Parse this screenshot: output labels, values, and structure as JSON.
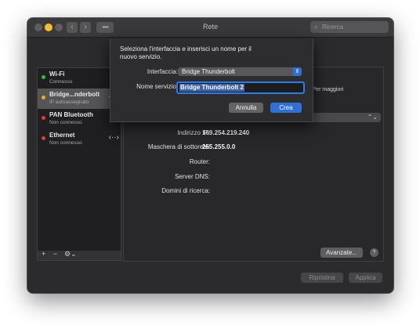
{
  "window": {
    "title": "Rete"
  },
  "search": {
    "placeholder": "Ricerca"
  },
  "services": [
    {
      "name": "Wi-Fi",
      "status": "Connesso",
      "dot_color": "#2fc02f",
      "icon": "wifi-icon"
    },
    {
      "name": "Bridge...nderbolt",
      "status": "IP autoassegnato",
      "dot_color": "#f5a623",
      "icon": "arrows-icon"
    },
    {
      "name": "PAN Bluetooth",
      "status": "Non connesso",
      "dot_color": "#e23a3a",
      "icon": "bluetooth-icon"
    },
    {
      "name": "Ethernet",
      "status": "Non connesso",
      "dot_color": "#e23a3a",
      "icon": "arrows-icon"
    }
  ],
  "main": {
    "truncated_text": "nesse. Per maggiori",
    "rows": [
      {
        "label": "Indirizzo IP:",
        "value": "169.254.219.240"
      },
      {
        "label": "Maschera di sottorete:",
        "value": "255.255.0.0"
      },
      {
        "label": "Router:",
        "value": ""
      },
      {
        "label": "Server DNS:",
        "value": ""
      },
      {
        "label": "Domini di ricerca:",
        "value": ""
      }
    ],
    "advanced_label": "Avanzate...",
    "help_label": "?",
    "revert_label": "Ripristina",
    "apply_label": "Applica"
  },
  "sheet": {
    "message": "Seleziona l'interfaccia e inserisci un nome per il nuovo servizio.",
    "interface_label": "Interfaccia:",
    "interface_value": "Bridge Thunderbolt",
    "service_label": "Nome servizio:",
    "service_value": "Bridge Thunderbolt 2",
    "cancel_label": "Annulla",
    "create_label": "Crea"
  },
  "sidebar_tools": {
    "add": "+",
    "remove": "−",
    "action": "⚙︎⌄"
  },
  "colors": {
    "accent": "#2f6fd6",
    "background": "#2b2b2d"
  }
}
